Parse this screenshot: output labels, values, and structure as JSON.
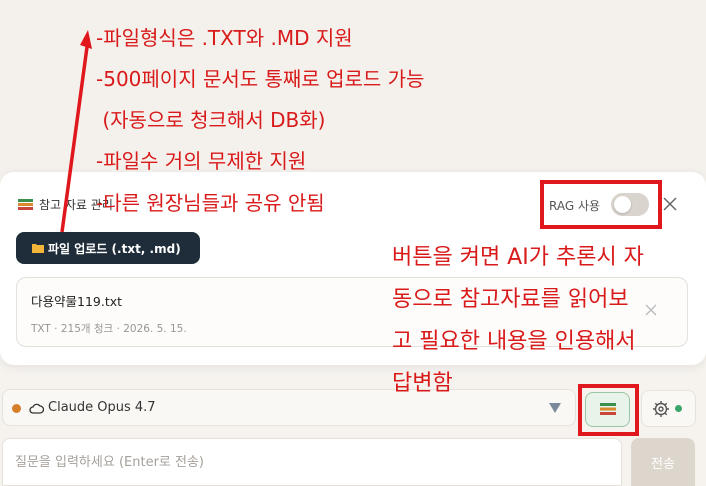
{
  "panel": {
    "title": "참고 자료 관리",
    "upload_label": "파일 업로드 (.txt, .md)",
    "rag_label": "RAG 사용",
    "rag_enabled": false
  },
  "file": {
    "name": "다용약물119.txt",
    "meta": "TXT · 215개 청크 · 2026. 5. 15."
  },
  "composer": {
    "model": "Claude Opus 4.7",
    "input_placeholder": "질문을 입력하세요 (Enter로 전송)",
    "send_label": "전송"
  },
  "annotations": {
    "top_lines": [
      "-파일형식은 .TXT와 .MD 지원",
      "-500페이지 문서도 통째로 업로드 가능",
      " (자동으로 청크해서 DB화)",
      "-파일수 거의 무제한 지원",
      "-다른 원장님들과 공유 안됨"
    ],
    "side_lines": [
      "버튼을 켜면 AI가 추론시 자",
      "동으로 참고자료를 읽어보",
      "고 필요한 내용을 인용해서",
      "답변함"
    ],
    "color": "#e0171d"
  },
  "colors": {
    "upload_button": "#1f2d3b",
    "status_dot": "#3aa56b",
    "model_dot": "#d57f2a"
  }
}
